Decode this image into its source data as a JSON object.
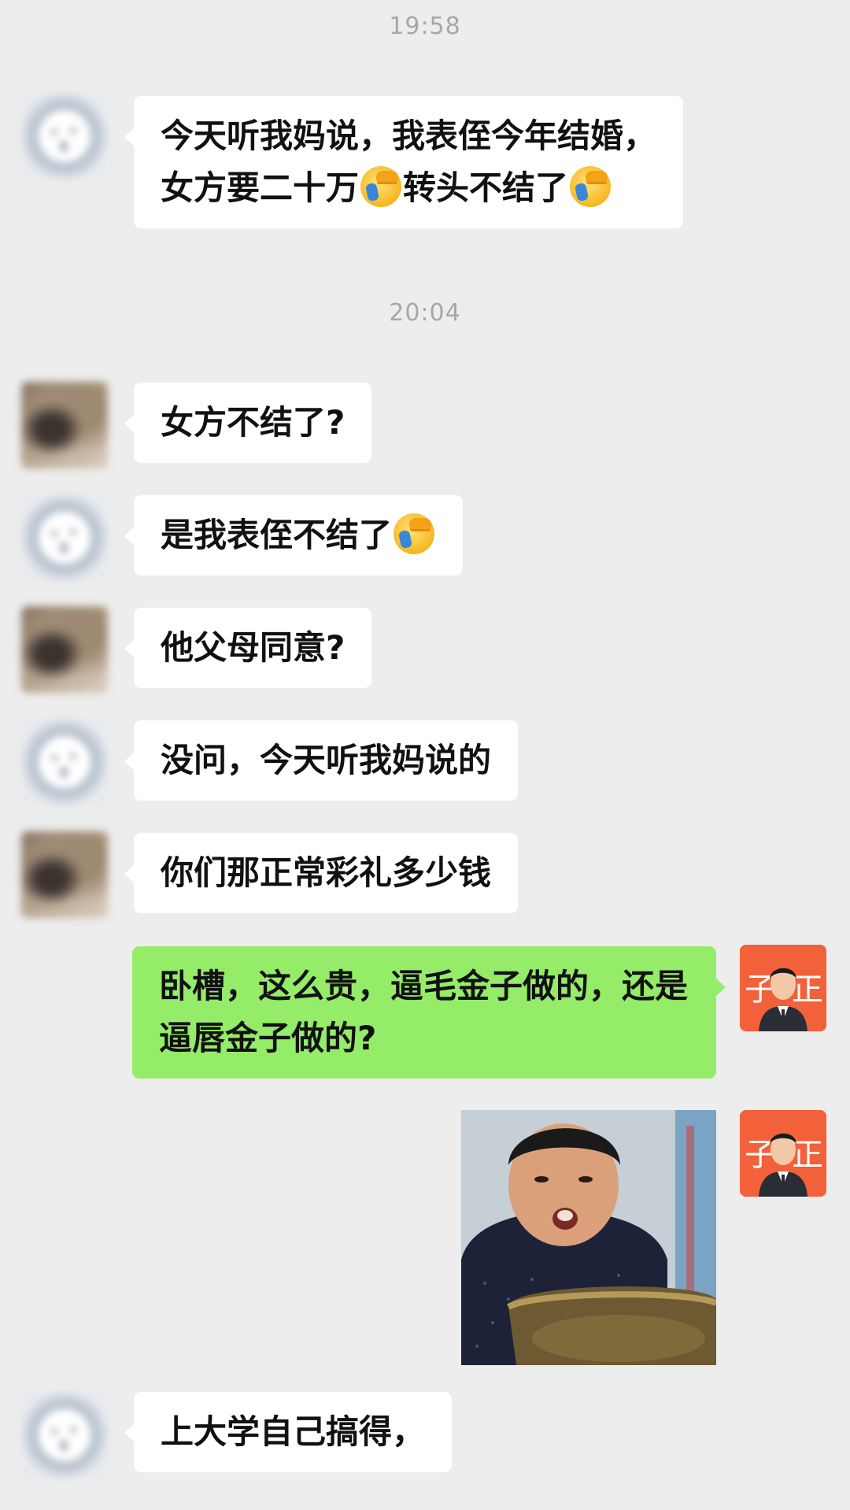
{
  "chat": {
    "time_1": "19:58",
    "time_2": "20:04",
    "msg_1_line_1": "今天听我妈说，我表侄今年结婚，",
    "msg_1_line_2a": "女方要二十万",
    "msg_1_line_2b": "转头不结了",
    "msg_2": "女方不结了?",
    "msg_3": "是我表侄不结了",
    "msg_4": "他父母同意?",
    "msg_5": "没问，今天听我妈说的",
    "msg_6": "你们那正常彩礼多少钱",
    "msg_7": "卧槽，这么贵，逼毛金子做的，还是逼唇金子做的?",
    "msg_8": "上大学自己搞得，"
  },
  "avatar_badge": {
    "left_char": "子",
    "right_char": "正"
  },
  "icons": {
    "emoji": "facepalm-emoji",
    "sticker": "sticker-image"
  },
  "colors": {
    "background": "#ededed",
    "bubble_in": "#ffffff",
    "bubble_out": "#95ec69",
    "timestamp": "#a7a7a7",
    "avatar_me_bg": "#f2613a"
  }
}
